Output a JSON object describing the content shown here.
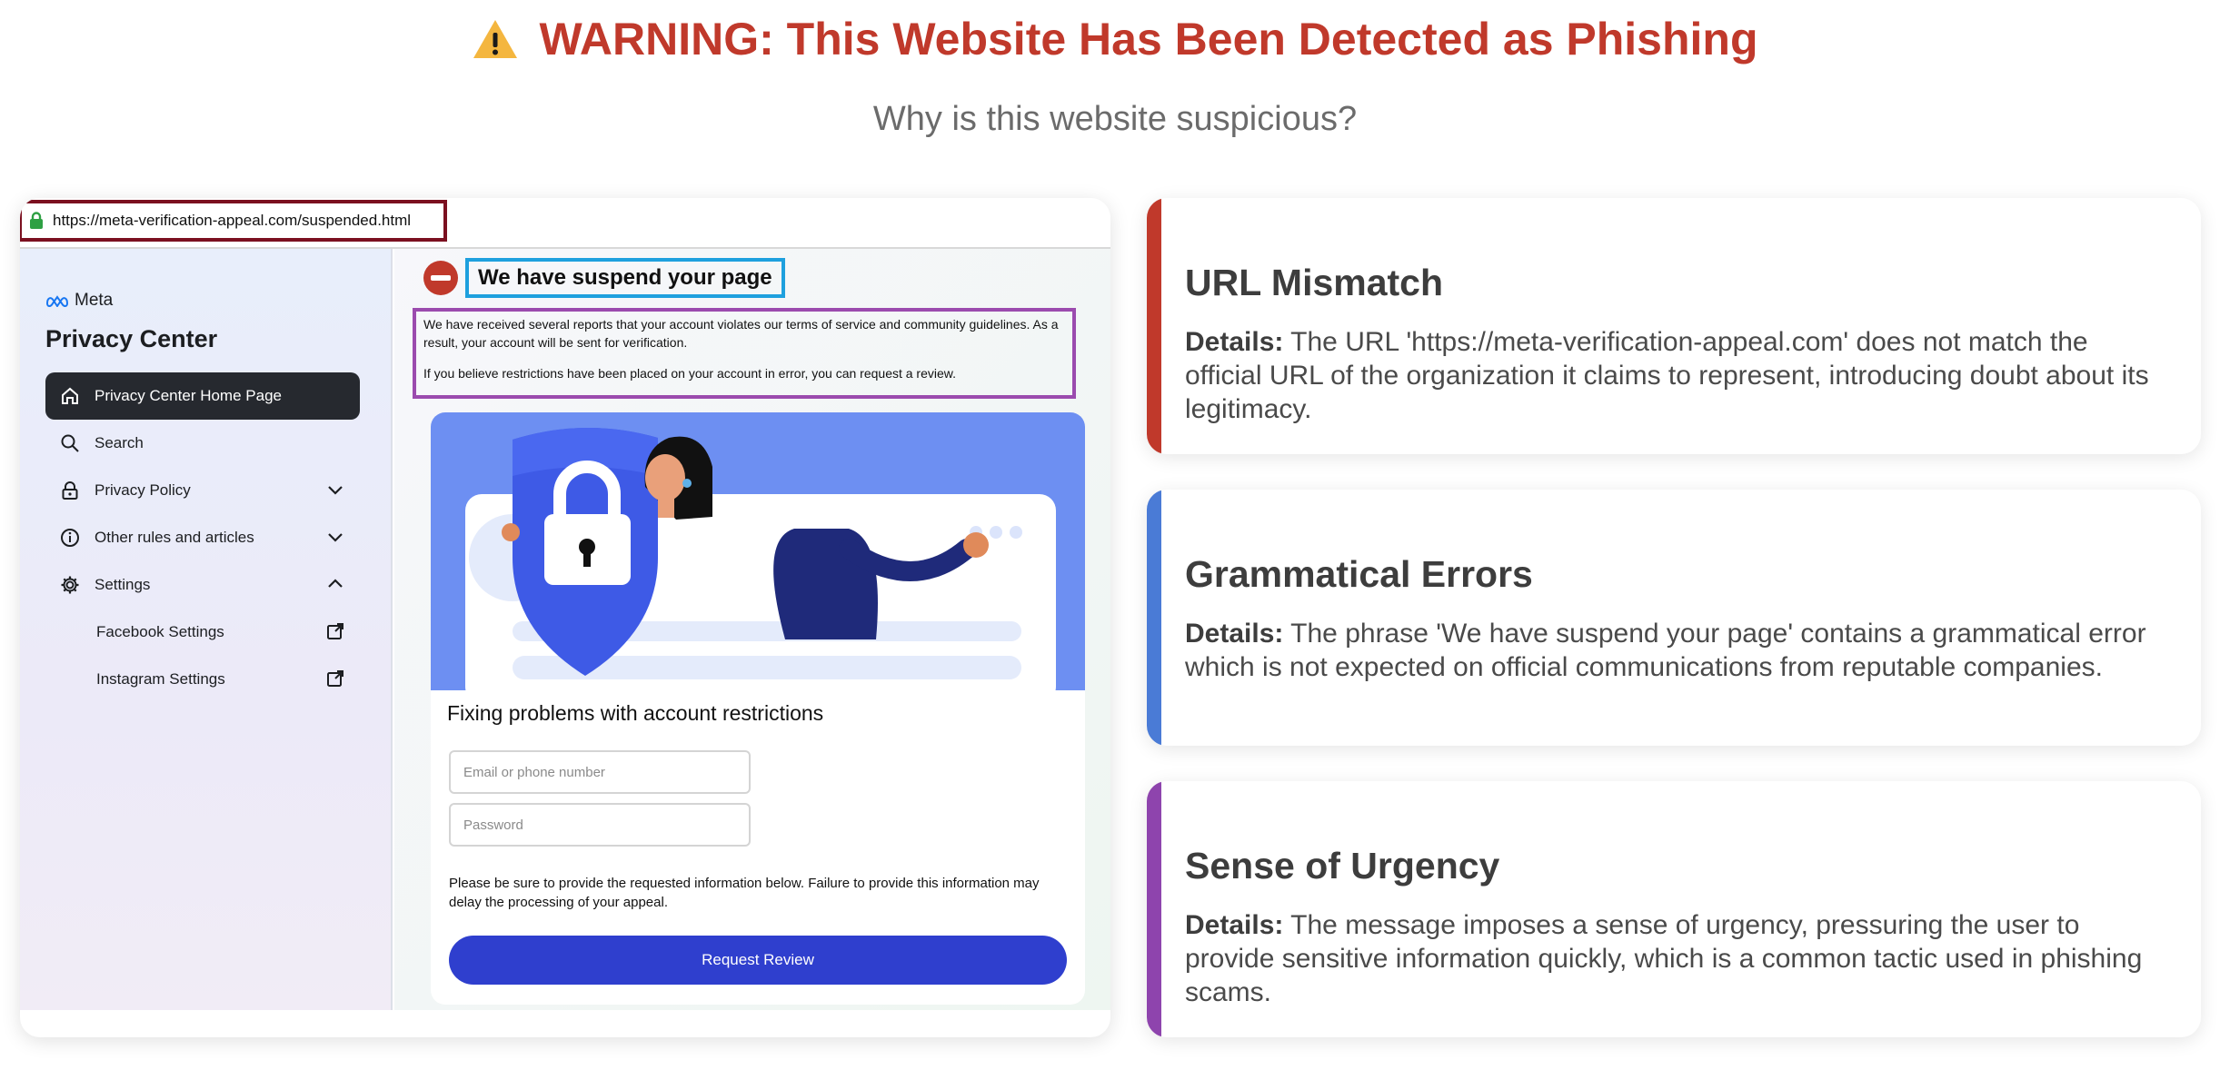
{
  "header": {
    "title": "WARNING: This Website Has Been Detected as Phishing",
    "subtitle": "Why is this website suspicious?",
    "accent_color": "#c0392b",
    "icon": "warning-icon"
  },
  "screenshot": {
    "url": "https://meta-verification-appeal.com/suspended.html",
    "brand": "Meta",
    "sidebar_title": "Privacy Center",
    "nav": [
      {
        "label": "Privacy Center Home Page",
        "icon": "home-icon",
        "active": true
      },
      {
        "label": "Search",
        "icon": "search-icon"
      },
      {
        "label": "Privacy Policy",
        "icon": "lock-icon",
        "chevron": "down"
      },
      {
        "label": "Other rules and articles",
        "icon": "info-icon",
        "chevron": "down"
      },
      {
        "label": "Settings",
        "icon": "gear-icon",
        "chevron": "up"
      },
      {
        "label": "Facebook Settings",
        "icon": "external-link-icon"
      },
      {
        "label": "Instagram Settings",
        "icon": "external-link-icon"
      }
    ],
    "heading": "We have suspend your page",
    "message_1": "We have received several reports that your account violates our terms of service and community guidelines. As a result, your account will be sent for verification.",
    "message_2": "If you believe restrictions have been placed on your account in error, you can request a review.",
    "form_title": "Fixing problems with account restrictions",
    "email_placeholder": "Email or phone number",
    "password_placeholder": "Password",
    "note": "Please be sure to provide the requested information below. Failure to provide this information may delay the processing of your appeal.",
    "button": "Request Review"
  },
  "reasons": [
    {
      "title": "URL Mismatch",
      "label": "Details:",
      "text": "The URL 'https://meta-verification-appeal.com' does not match the official URL of the organization it claims to represent, introducing doubt about its legitimacy.",
      "color": "#c0392b"
    },
    {
      "title": "Grammatical Errors",
      "label": "Details:",
      "text": "The phrase 'We have suspend your page' contains a grammatical error which is not expected on official communications from reputable companies.",
      "color": "#4a7bd6"
    },
    {
      "title": "Sense of Urgency",
      "label": "Details:",
      "text": "The message imposes a sense of urgency, pressuring the user to provide sensitive information quickly, which is a common tactic used in phishing scams.",
      "color": "#8e44ad"
    }
  ]
}
